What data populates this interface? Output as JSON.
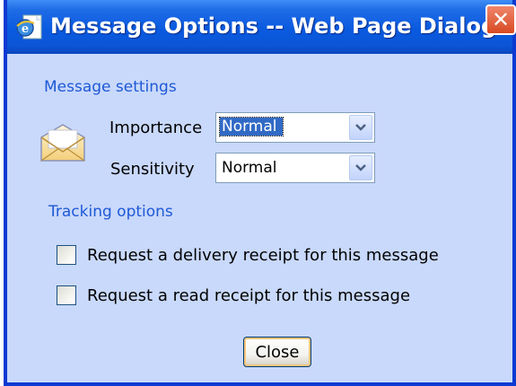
{
  "window": {
    "title": "Message Options -- Web Page Dialog",
    "close_glyph": "✕"
  },
  "message_settings": {
    "heading": "Message settings",
    "importance": {
      "label": "Importance",
      "value": "Normal"
    },
    "sensitivity": {
      "label": "Sensitivity",
      "value": "Normal"
    }
  },
  "tracking_options": {
    "heading": "Tracking options",
    "delivery_receipt": {
      "label": "Request a delivery receipt for this message",
      "checked": false
    },
    "read_receipt": {
      "label": "Request a read receipt for this message",
      "checked": false
    }
  },
  "footer": {
    "close_label": "Close"
  },
  "colors": {
    "dialog_bg": "#c9d9fb",
    "titlebar": "#0a5ae0",
    "heading_text": "#1e59d6",
    "close_x": "#e0542d"
  },
  "icons": {
    "title": "ie-page-icon",
    "envelope": "envelope-icon",
    "dropdown": "chevron-down-icon"
  }
}
